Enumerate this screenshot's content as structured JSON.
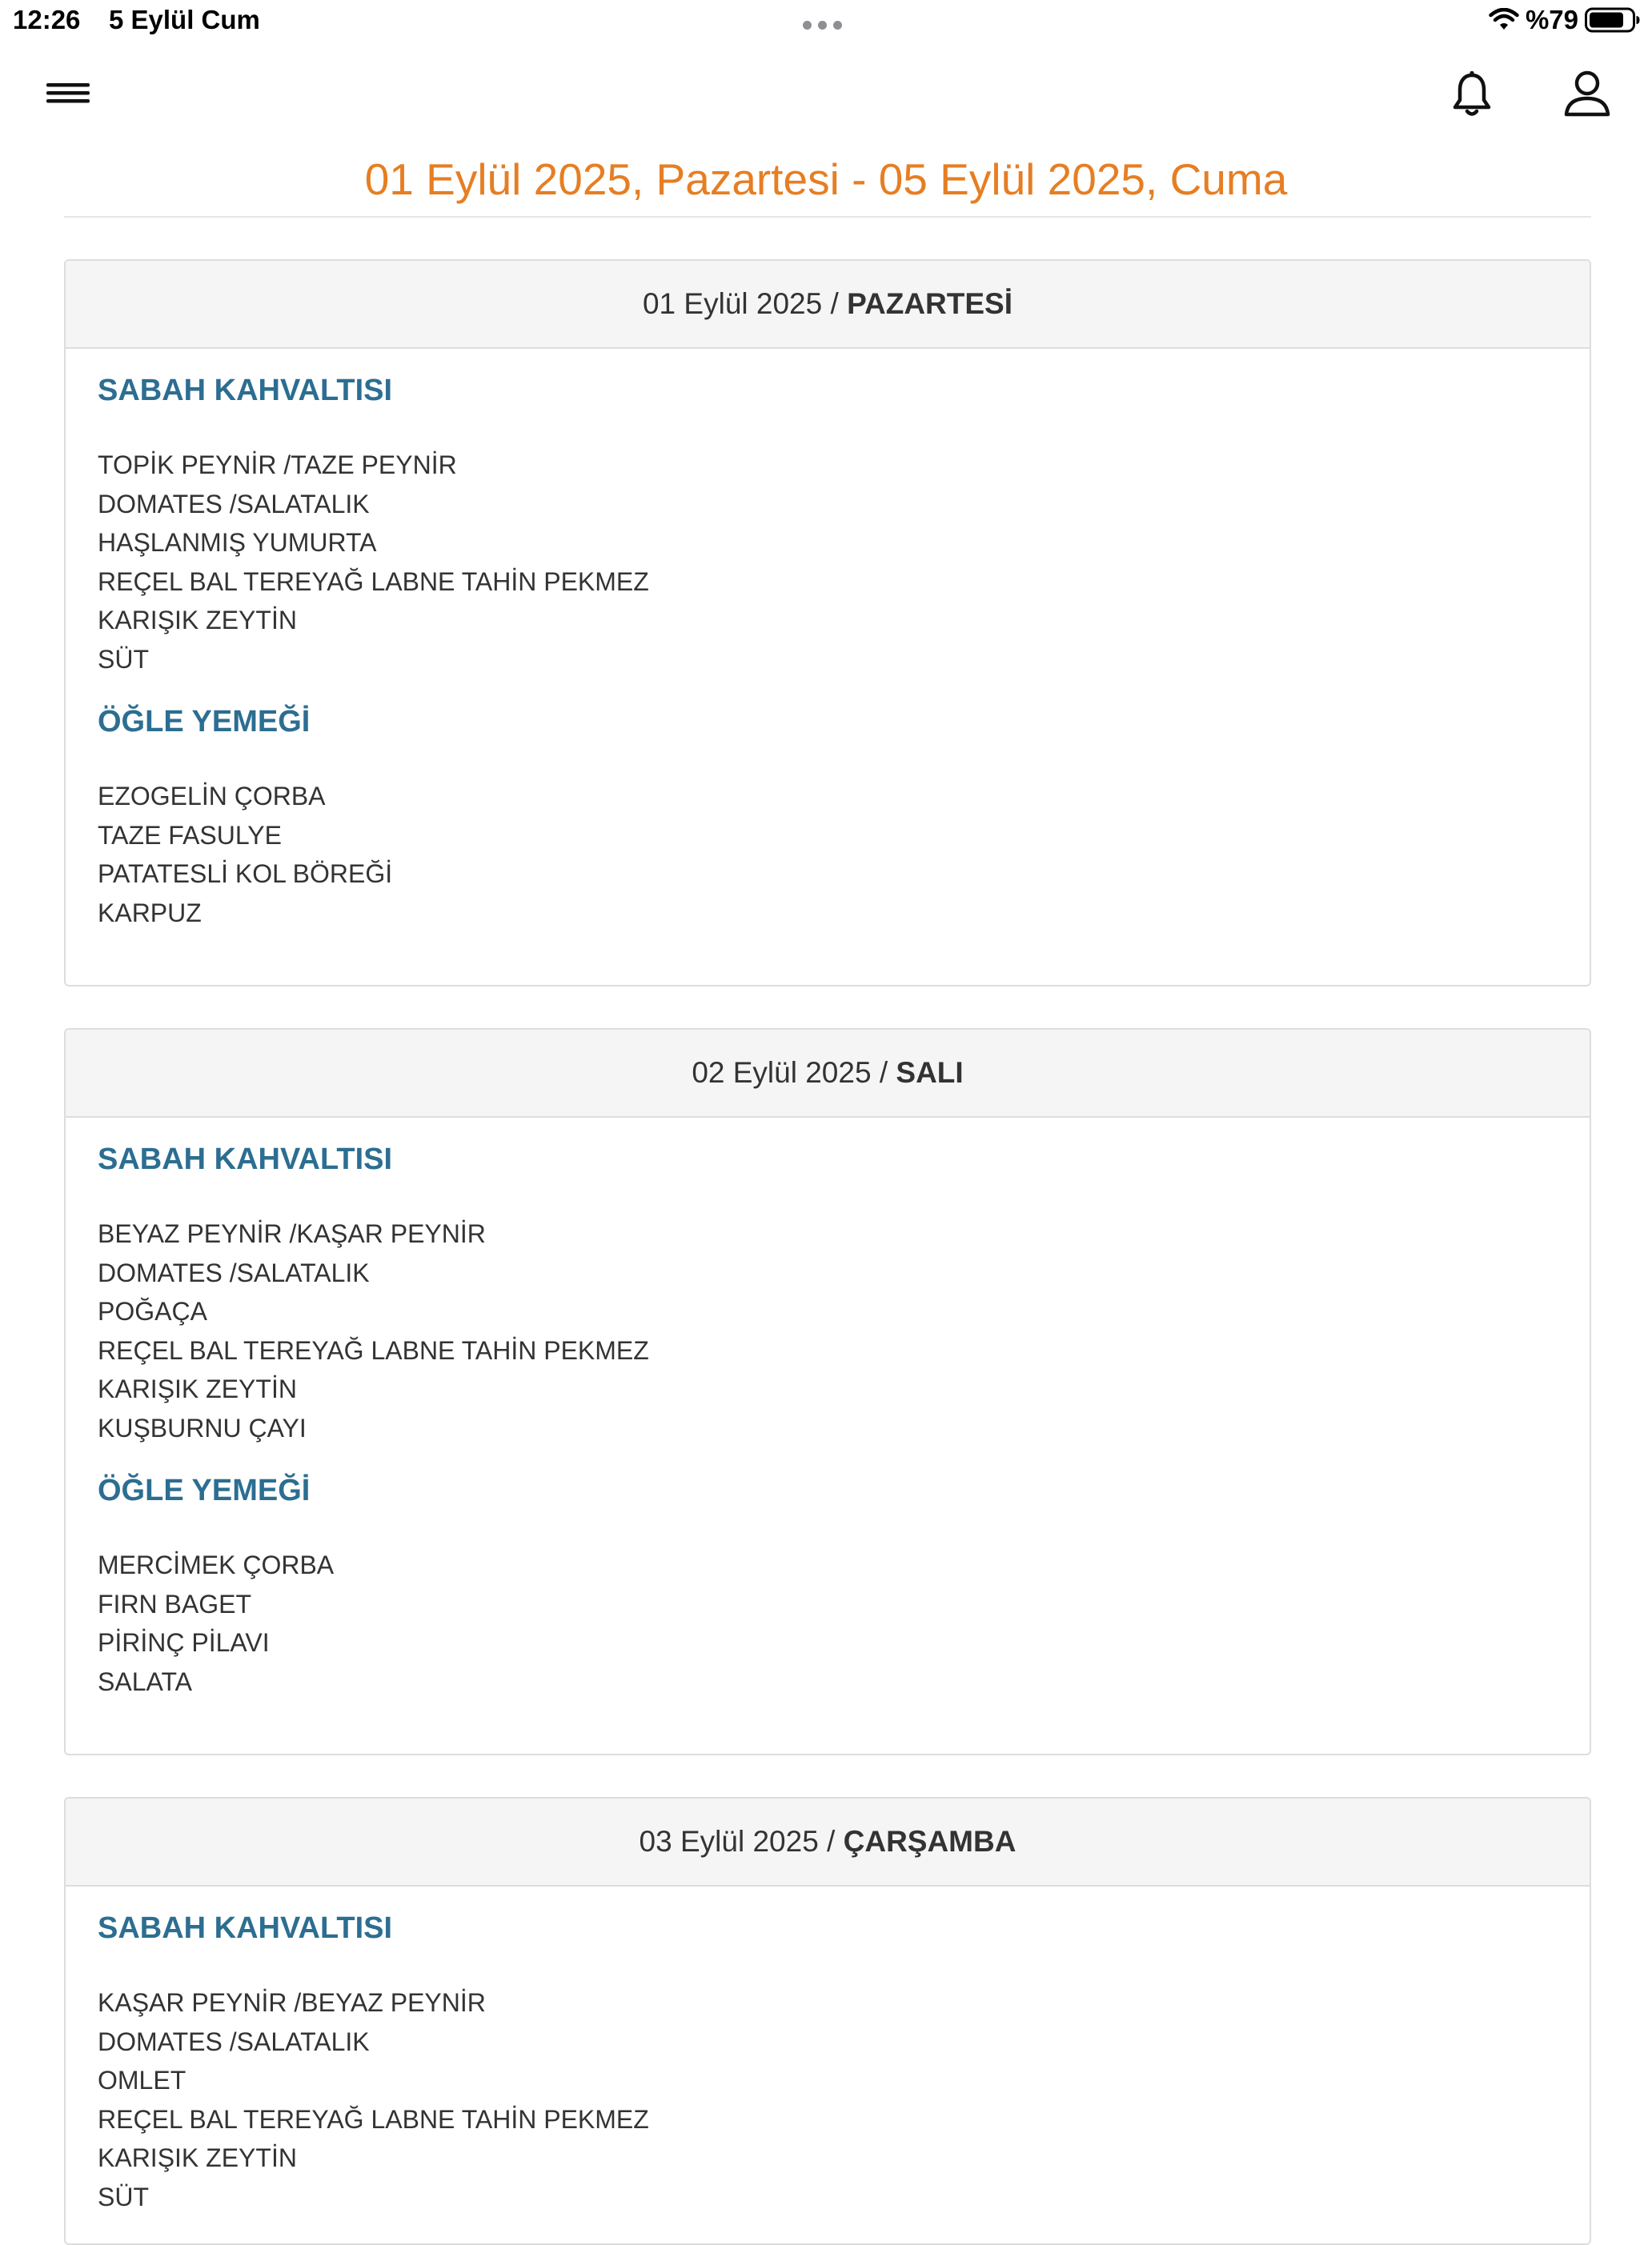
{
  "status_bar": {
    "time": "12:26",
    "date": "5 Eylül Cum",
    "battery": "%79"
  },
  "header": {
    "menu_icon": "hamburger-icon",
    "notification_icon": "bell-icon",
    "user_icon": "user-icon",
    "title_start": "01 Eylül 2025, Pazartesi",
    "title_sep": " - ",
    "title_end": "05 Eylül 2025, Cuma"
  },
  "colors": {
    "title": "#e67e22",
    "meal_heading": "#2c6e91",
    "panel_heading_bg": "#f5f5f5",
    "panel_border": "#dddddd"
  },
  "days": [
    {
      "date": "01 Eylül 2025",
      "sep": " / ",
      "day": "PAZARTESİ",
      "meals": [
        {
          "title": "SABAH KAHVALTISI",
          "items": [
            "TOPİK PEYNİR /TAZE PEYNİR",
            "DOMATES /SALATALIK",
            "HAŞLANMIŞ YUMURTA",
            "REÇEL BAL TEREYAĞ LABNE TAHİN PEKMEZ",
            "KARIŞIK ZEYTİN",
            "SÜT"
          ]
        },
        {
          "title": "ÖĞLE YEMEĞİ",
          "items": [
            "EZOGELİN ÇORBA",
            "TAZE FASULYE",
            "PATATESLİ KOL BÖREĞİ",
            "KARPUZ"
          ]
        }
      ]
    },
    {
      "date": "02 Eylül 2025",
      "sep": " / ",
      "day": "SALI",
      "meals": [
        {
          "title": "SABAH KAHVALTISI",
          "items": [
            "BEYAZ PEYNİR /KAŞAR PEYNİR",
            "DOMATES /SALATALIK",
            "POĞAÇA",
            "REÇEL BAL TEREYAĞ LABNE TAHİN PEKMEZ",
            "KARIŞIK ZEYTİN",
            "KUŞBURNU ÇAYI"
          ]
        },
        {
          "title": "ÖĞLE YEMEĞİ",
          "items": [
            "MERCİMEK ÇORBA",
            "FIRN BAGET",
            "PİRİNÇ PİLAVI",
            "SALATA"
          ]
        }
      ]
    },
    {
      "date": "03 Eylül 2025",
      "sep": " / ",
      "day": "ÇARŞAMBA",
      "meals": [
        {
          "title": "SABAH KAHVALTISI",
          "items": [
            "KAŞAR PEYNİR /BEYAZ PEYNİR",
            "DOMATES /SALATALIK",
            "OMLET",
            "REÇEL BAL TEREYAĞ LABNE TAHİN PEKMEZ",
            "KARIŞIK ZEYTİN",
            "SÜT"
          ]
        }
      ]
    }
  ]
}
